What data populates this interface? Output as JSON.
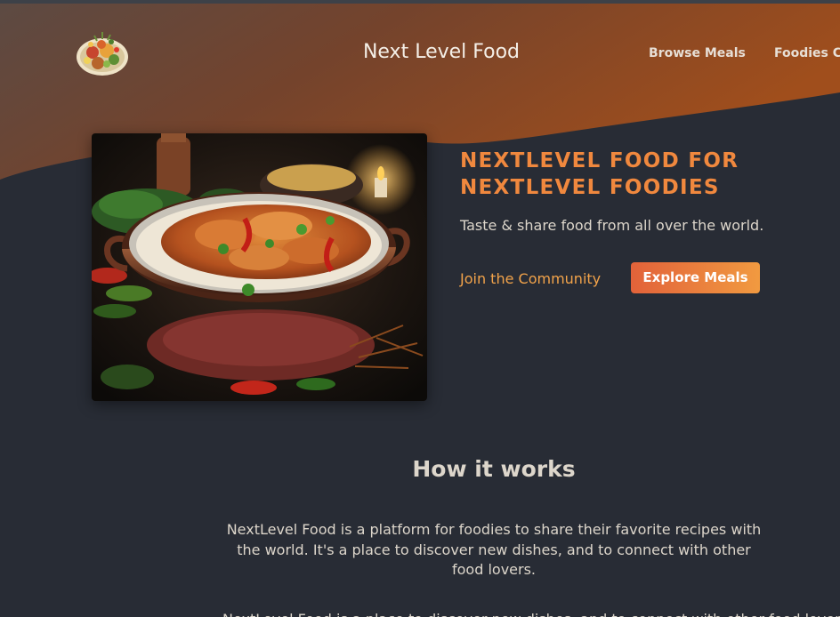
{
  "header": {
    "logo_alt": "A plate with food on it",
    "title": "Next Level Food",
    "nav": {
      "browse_meals": "Browse Meals",
      "foodies_community": "Foodies Community"
    }
  },
  "hero": {
    "image_alt": "A bowl of curry with rice, herbs and red chilies",
    "headline": "NEXTLEVEL FOOD FOR NEXTLEVEL FOODIES",
    "tagline": "Taste & share food from all over the world.",
    "join_link": "Join the Community",
    "explore_button": "Explore Meals"
  },
  "how_it_works": {
    "title": "How it works",
    "body": "NextLevel Food is a platform for foodies to share their favorite recipes with the world. It's a place to discover new dishes, and to connect with other food lovers.",
    "body_more": "NextLevel Food is a place to discover new dishes, and to connect with other food lovers."
  },
  "colors": {
    "background": "#282c35",
    "header_gradient_left": "#5a4740",
    "header_gradient_right": "#9a4d1f",
    "accent_orange": "#f0883e",
    "link_orange": "#f2a34a",
    "button_gradient_start": "#e2623a",
    "button_gradient_end": "#f19a40",
    "text_light": "#ddd6cb"
  }
}
